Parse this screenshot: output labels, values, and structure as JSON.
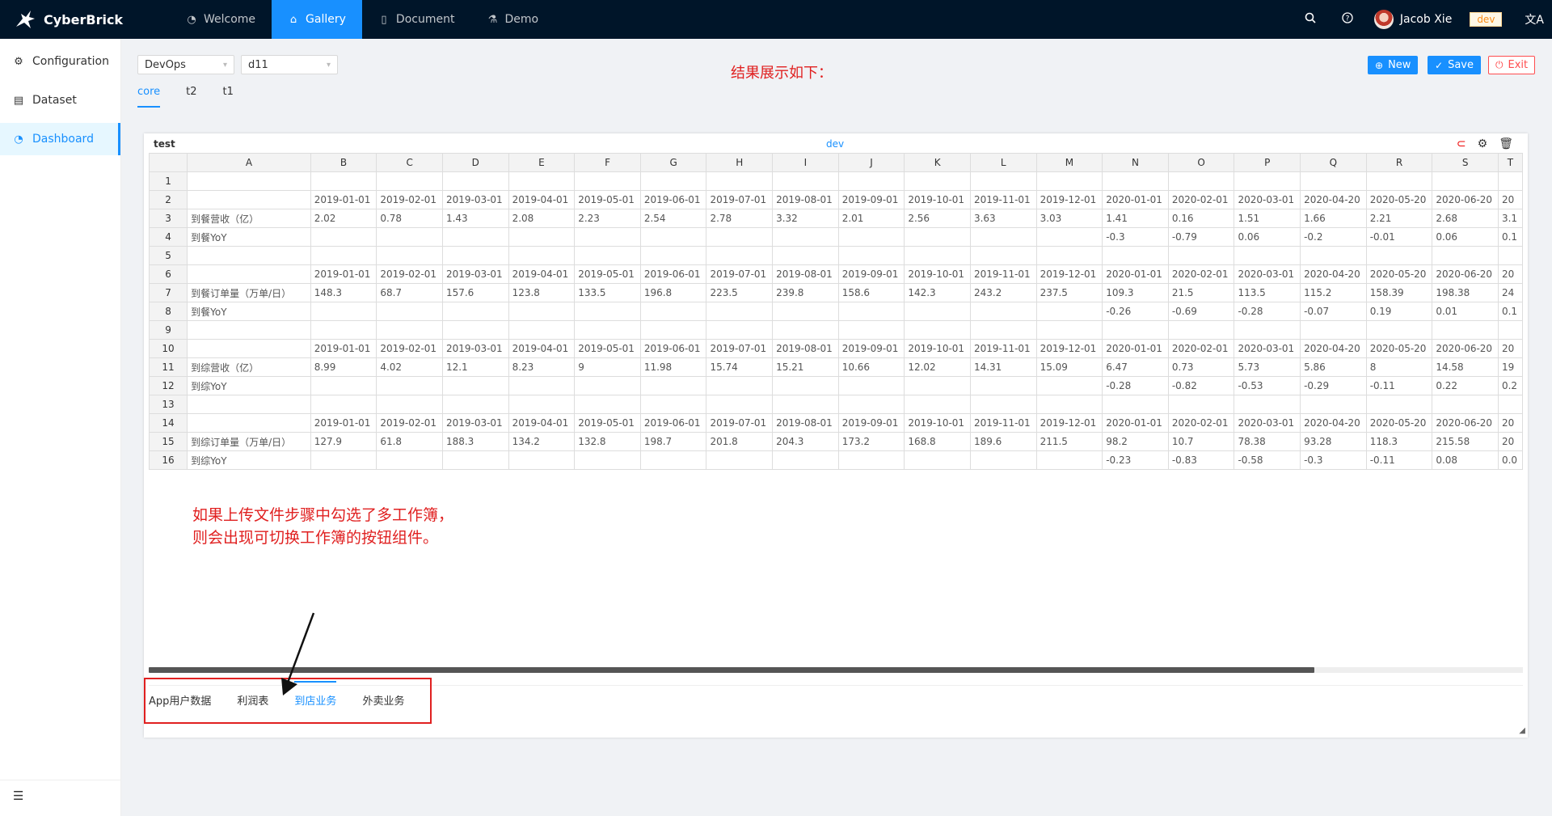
{
  "brand": {
    "name": "CyberBrick"
  },
  "topnav": [
    {
      "label": "Welcome",
      "icon": "dashboard-icon"
    },
    {
      "label": "Gallery",
      "icon": "bank-icon",
      "active": true
    },
    {
      "label": "Document",
      "icon": "book-icon"
    },
    {
      "label": "Demo",
      "icon": "experiment-icon"
    }
  ],
  "user": {
    "name": "Jacob Xie",
    "env": "dev"
  },
  "sidebar": {
    "items": [
      {
        "label": "Configuration",
        "icon": "gear-icon"
      },
      {
        "label": "Dataset",
        "icon": "database-icon"
      },
      {
        "label": "Dashboard",
        "icon": "dashboard-icon",
        "active": true
      }
    ]
  },
  "filters": {
    "group": "DevOps",
    "dashboard": "d11"
  },
  "tabs": [
    {
      "label": "core",
      "active": true
    },
    {
      "label": "t2"
    },
    {
      "label": "t1"
    }
  ],
  "result_note": "结果展示如下：",
  "buttons": {
    "new": "New",
    "save": "Save",
    "exit": "Exit"
  },
  "panel": {
    "title": "test",
    "env": "dev"
  },
  "sheet": {
    "columns": [
      "",
      "A",
      "B",
      "C",
      "D",
      "E",
      "F",
      "G",
      "H",
      "I",
      "J",
      "K",
      "L",
      "M",
      "N",
      "O",
      "P",
      "Q",
      "R",
      "S",
      "T"
    ],
    "rows": [
      [
        "1",
        "",
        "",
        "",
        "",
        "",
        "",
        "",
        "",
        "",
        "",
        "",
        "",
        "",
        "",
        "",
        "",
        "",
        "",
        "",
        ""
      ],
      [
        "2",
        "",
        "2019-01-01",
        "2019-02-01",
        "2019-03-01",
        "2019-04-01",
        "2019-05-01",
        "2019-06-01",
        "2019-07-01",
        "2019-08-01",
        "2019-09-01",
        "2019-10-01",
        "2019-11-01",
        "2019-12-01",
        "2020-01-01",
        "2020-02-01",
        "2020-03-01",
        "2020-04-20",
        "2020-05-20",
        "2020-06-20",
        "20"
      ],
      [
        "3",
        "到餐营收（亿）",
        "2.02",
        "0.78",
        "1.43",
        "2.08",
        "2.23",
        "2.54",
        "2.78",
        "3.32",
        "2.01",
        "2.56",
        "3.63",
        "3.03",
        "1.41",
        "0.16",
        "1.51",
        "1.66",
        "2.21",
        "2.68",
        "3.1"
      ],
      [
        "4",
        "到餐YoY",
        "",
        "",
        "",
        "",
        "",
        "",
        "",
        "",
        "",
        "",
        "",
        "",
        "-0.3",
        "-0.79",
        "0.06",
        "-0.2",
        "-0.01",
        "0.06",
        "0.1"
      ],
      [
        "5",
        "",
        "",
        "",
        "",
        "",
        "",
        "",
        "",
        "",
        "",
        "",
        "",
        "",
        "",
        "",
        "",
        "",
        "",
        "",
        ""
      ],
      [
        "6",
        "",
        "2019-01-01",
        "2019-02-01",
        "2019-03-01",
        "2019-04-01",
        "2019-05-01",
        "2019-06-01",
        "2019-07-01",
        "2019-08-01",
        "2019-09-01",
        "2019-10-01",
        "2019-11-01",
        "2019-12-01",
        "2020-01-01",
        "2020-02-01",
        "2020-03-01",
        "2020-04-20",
        "2020-05-20",
        "2020-06-20",
        "20"
      ],
      [
        "7",
        "到餐订单量（万单/日）",
        "148.3",
        "68.7",
        "157.6",
        "123.8",
        "133.5",
        "196.8",
        "223.5",
        "239.8",
        "158.6",
        "142.3",
        "243.2",
        "237.5",
        "109.3",
        "21.5",
        "113.5",
        "115.2",
        "158.39",
        "198.38",
        "24"
      ],
      [
        "8",
        "到餐YoY",
        "",
        "",
        "",
        "",
        "",
        "",
        "",
        "",
        "",
        "",
        "",
        "",
        "-0.26",
        "-0.69",
        "-0.28",
        "-0.07",
        "0.19",
        "0.01",
        "0.1"
      ],
      [
        "9",
        "",
        "",
        "",
        "",
        "",
        "",
        "",
        "",
        "",
        "",
        "",
        "",
        "",
        "",
        "",
        "",
        "",
        "",
        "",
        ""
      ],
      [
        "10",
        "",
        "2019-01-01",
        "2019-02-01",
        "2019-03-01",
        "2019-04-01",
        "2019-05-01",
        "2019-06-01",
        "2019-07-01",
        "2019-08-01",
        "2019-09-01",
        "2019-10-01",
        "2019-11-01",
        "2019-12-01",
        "2020-01-01",
        "2020-02-01",
        "2020-03-01",
        "2020-04-20",
        "2020-05-20",
        "2020-06-20",
        "20"
      ],
      [
        "11",
        "到综营收（亿）",
        "8.99",
        "4.02",
        "12.1",
        "8.23",
        "9",
        "11.98",
        "15.74",
        "15.21",
        "10.66",
        "12.02",
        "14.31",
        "15.09",
        "6.47",
        "0.73",
        "5.73",
        "5.86",
        "8",
        "14.58",
        "19"
      ],
      [
        "12",
        "到综YoY",
        "",
        "",
        "",
        "",
        "",
        "",
        "",
        "",
        "",
        "",
        "",
        "",
        "-0.28",
        "-0.82",
        "-0.53",
        "-0.29",
        "-0.11",
        "0.22",
        "0.2"
      ],
      [
        "13",
        "",
        "",
        "",
        "",
        "",
        "",
        "",
        "",
        "",
        "",
        "",
        "",
        "",
        "",
        "",
        "",
        "",
        "",
        "",
        ""
      ],
      [
        "14",
        "",
        "2019-01-01",
        "2019-02-01",
        "2019-03-01",
        "2019-04-01",
        "2019-05-01",
        "2019-06-01",
        "2019-07-01",
        "2019-08-01",
        "2019-09-01",
        "2019-10-01",
        "2019-11-01",
        "2019-12-01",
        "2020-01-01",
        "2020-02-01",
        "2020-03-01",
        "2020-04-20",
        "2020-05-20",
        "2020-06-20",
        "20"
      ],
      [
        "15",
        "到综订单量（万单/日）",
        "127.9",
        "61.8",
        "188.3",
        "134.2",
        "132.8",
        "198.7",
        "201.8",
        "204.3",
        "173.2",
        "168.8",
        "189.6",
        "211.5",
        "98.2",
        "10.7",
        "78.38",
        "93.28",
        "118.3",
        "215.58",
        "20"
      ],
      [
        "16",
        "到综YoY",
        "",
        "",
        "",
        "",
        "",
        "",
        "",
        "",
        "",
        "",
        "",
        "",
        "-0.23",
        "-0.83",
        "-0.58",
        "-0.3",
        "-0.11",
        "0.08",
        "0.0"
      ]
    ]
  },
  "workbook_tabs": [
    {
      "label": "App用户数据"
    },
    {
      "label": "利润表"
    },
    {
      "label": "到店业务",
      "active": true
    },
    {
      "label": "外卖业务"
    }
  ],
  "annotation": {
    "line1": "如果上传文件步骤中勾选了多工作簿，",
    "line2": "则会出现可切换工作簿的按钮组件。"
  },
  "colors": {
    "accent": "#1890ff",
    "annotation": "#e02020",
    "topbar": "#001529"
  }
}
